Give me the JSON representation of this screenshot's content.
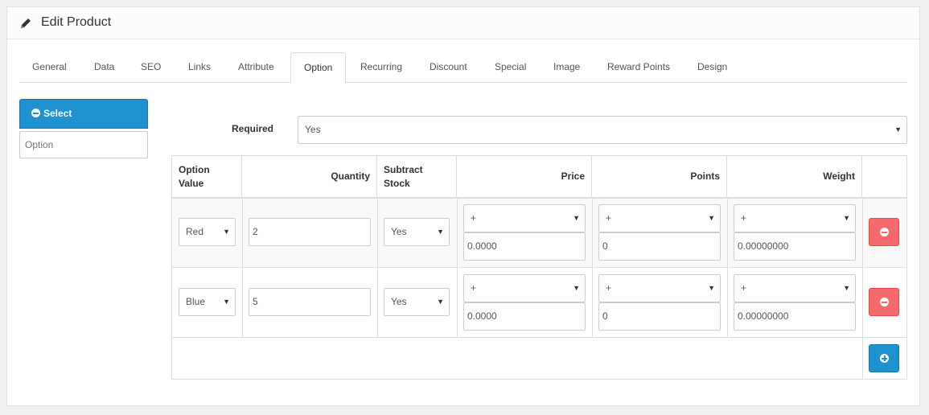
{
  "header": {
    "title": "Edit Product"
  },
  "tabs": [
    {
      "label": "General"
    },
    {
      "label": "Data"
    },
    {
      "label": "SEO"
    },
    {
      "label": "Links"
    },
    {
      "label": "Attribute"
    },
    {
      "label": "Option"
    },
    {
      "label": "Recurring"
    },
    {
      "label": "Discount"
    },
    {
      "label": "Special"
    },
    {
      "label": "Image"
    },
    {
      "label": "Reward Points"
    },
    {
      "label": "Design"
    }
  ],
  "active_tab": "Option",
  "sidebar": {
    "select_label": "Select",
    "option_placeholder": "Option"
  },
  "required": {
    "label": "Required",
    "value": "Yes"
  },
  "table": {
    "headers": {
      "option_value": "Option Value",
      "quantity": "Quantity",
      "subtract_stock": "Subtract Stock",
      "price": "Price",
      "points": "Points",
      "weight": "Weight"
    },
    "rows": [
      {
        "option_value": "Red",
        "quantity": "2",
        "subtract": "Yes",
        "price_prefix": "+",
        "price": "0.0000",
        "points_prefix": "+",
        "points": "0",
        "weight_prefix": "+",
        "weight": "0.00000000"
      },
      {
        "option_value": "Blue",
        "quantity": "5",
        "subtract": "Yes",
        "price_prefix": "+",
        "price": "0.0000",
        "points_prefix": "+",
        "points": "0",
        "weight_prefix": "+",
        "weight": "0.00000000"
      }
    ]
  },
  "colors": {
    "primary": "#1e91cf",
    "danger": "#f56b6b"
  }
}
